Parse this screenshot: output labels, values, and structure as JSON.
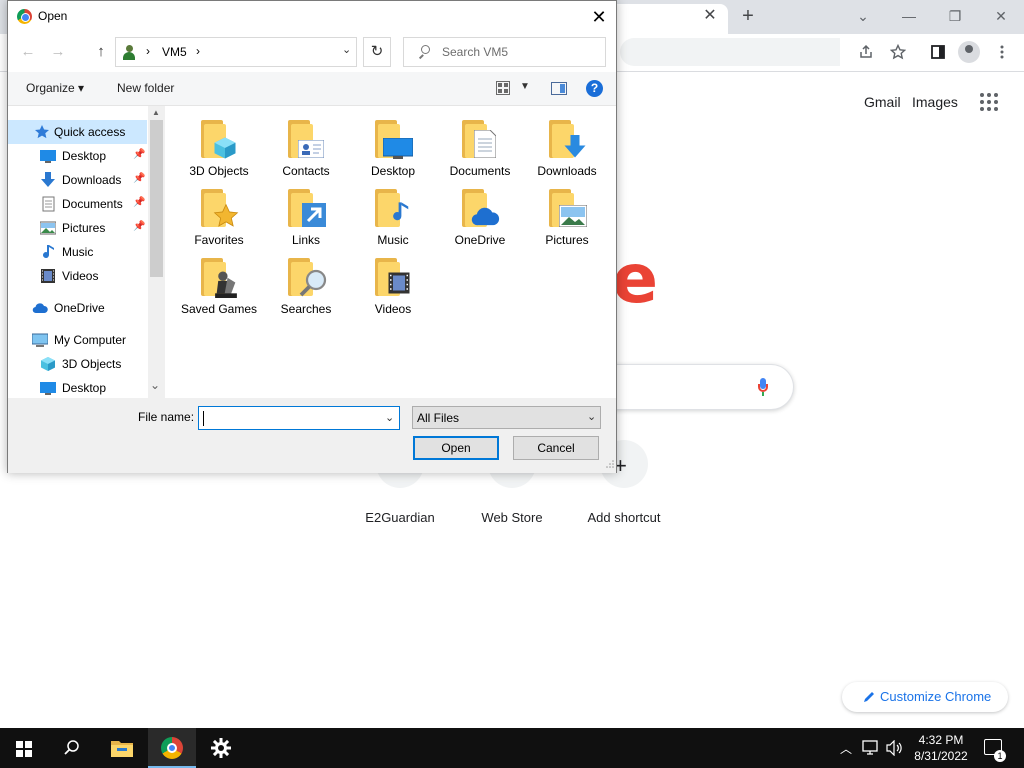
{
  "chrome": {
    "tab_close": "✕",
    "new_tab": "+",
    "win_controls": {
      "search_tabs": "⌄",
      "minimize": "—",
      "restore": "❐",
      "close": "✕"
    },
    "toolbar_icons": [
      "share-icon",
      "star-icon",
      "side-panel-icon",
      "profile-icon",
      "kebab-menu-icon"
    ],
    "header_links": [
      "Gmail",
      "Images"
    ],
    "logo_fragment": "e",
    "shortcuts": [
      {
        "label": "E2Guardian"
      },
      {
        "label": "Web Store"
      },
      {
        "label": "Add shortcut"
      }
    ],
    "customize_label": "Customize Chrome",
    "colors": {
      "logo_red": "#ea4335",
      "link_blue": "#1a73e8"
    }
  },
  "dialog": {
    "title": "Open",
    "close": "✕",
    "nav": {
      "back": "←",
      "forward": "→",
      "up": "↑"
    },
    "address": {
      "segment": "VM5",
      "chevron": "›"
    },
    "refresh": "↻",
    "search_placeholder": "Search VM5",
    "commands": {
      "organize": "Organize ▾",
      "new_folder": "New folder",
      "help": "?"
    },
    "nav_pane": [
      {
        "label": "Quick access",
        "icon": "star-icon",
        "selected": true,
        "pinned": false,
        "indent": 1
      },
      {
        "label": "Desktop",
        "icon": "desktop-icon",
        "pinned": true,
        "indent": 2
      },
      {
        "label": "Downloads",
        "icon": "download-icon",
        "pinned": true,
        "indent": 2
      },
      {
        "label": "Documents",
        "icon": "documents-icon",
        "pinned": true,
        "indent": 2
      },
      {
        "label": "Pictures",
        "icon": "pictures-icon",
        "pinned": true,
        "indent": 2
      },
      {
        "label": "Music",
        "icon": "music-icon",
        "pinned": false,
        "indent": 2
      },
      {
        "label": "Videos",
        "icon": "videos-icon",
        "pinned": false,
        "indent": 2
      },
      {
        "label": "OneDrive",
        "icon": "cloud-icon",
        "pinned": false,
        "indent": 1
      },
      {
        "label": "My Computer",
        "icon": "computer-icon",
        "pinned": false,
        "indent": 1
      },
      {
        "label": "3D Objects",
        "icon": "cube-icon",
        "pinned": false,
        "indent": 2
      },
      {
        "label": "Desktop",
        "icon": "desktop-icon",
        "pinned": false,
        "indent": 2
      }
    ],
    "files": [
      {
        "label": "3D Objects",
        "emblem": "cube"
      },
      {
        "label": "Contacts",
        "emblem": "contact-card"
      },
      {
        "label": "Desktop",
        "emblem": "monitor"
      },
      {
        "label": "Documents",
        "emblem": "document"
      },
      {
        "label": "Downloads",
        "emblem": "download-arrow"
      },
      {
        "label": "Favorites",
        "emblem": "star"
      },
      {
        "label": "Links",
        "emblem": "link-arrow"
      },
      {
        "label": "Music",
        "emblem": "note"
      },
      {
        "label": "OneDrive",
        "emblem": "cloud"
      },
      {
        "label": "Pictures",
        "emblem": "landscape"
      },
      {
        "label": "Saved Games",
        "emblem": "chess-piece"
      },
      {
        "label": "Searches",
        "emblem": "magnifier"
      },
      {
        "label": "Videos",
        "emblem": "film"
      }
    ],
    "file_name_label": "File name:",
    "file_name_value": "",
    "file_type": "All Files",
    "open_label": "Open",
    "cancel_label": "Cancel"
  },
  "taskbar": {
    "apps": [
      "windows-start-icon",
      "search-icon",
      "file-explorer-icon",
      "chrome-icon",
      "settings-gear-icon"
    ],
    "active_app": "chrome-icon",
    "tray_chevron": "︿",
    "time": "4:32 PM",
    "date": "8/31/2022",
    "notification_count": "1"
  }
}
